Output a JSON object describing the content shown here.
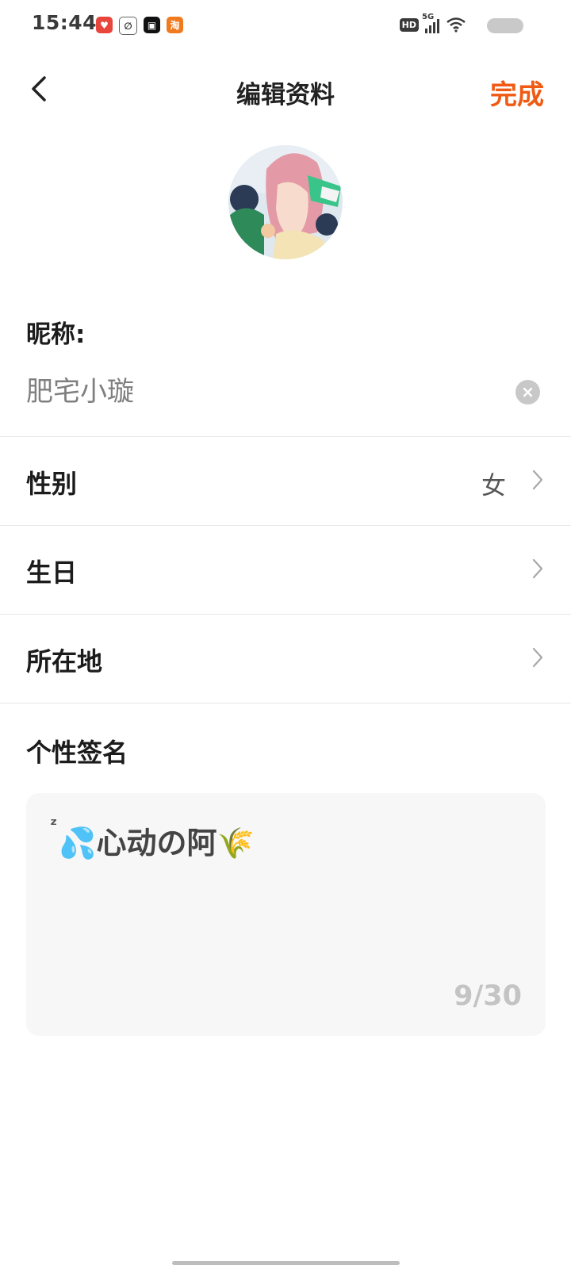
{
  "status_bar": {
    "time": "15:44",
    "network_label": "5G",
    "hd_label": "HD",
    "app_icons": [
      "app-icon-red",
      "app-icon-swirl",
      "app-icon-video",
      "app-icon-taobao"
    ]
  },
  "header": {
    "title": "编辑资料",
    "done_label": "完成",
    "accent_color": "#f05a13"
  },
  "nickname": {
    "label": "昵称:",
    "value": "肥宅小璇"
  },
  "rows": [
    {
      "label": "性别",
      "value": "女"
    },
    {
      "label": "生日",
      "value": ""
    },
    {
      "label": "所在地",
      "value": ""
    }
  ],
  "signature": {
    "label": "个性签名",
    "prefix": "ᶻ",
    "text": "💦心动の阿🌾",
    "count": "9/30"
  }
}
